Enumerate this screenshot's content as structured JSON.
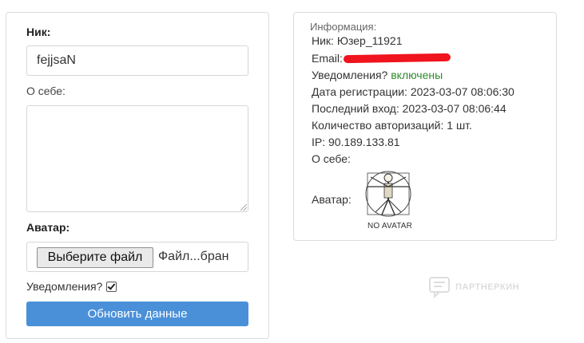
{
  "profile_form": {
    "nick_label": "Ник:",
    "nick_value": "fejjsaN",
    "about_label": "О себе:",
    "about_value": "",
    "avatar_label": "Аватар:",
    "file_button_label": "Выберите файл",
    "file_status": "Файл...бран",
    "notifications_label": "Уведомления?",
    "notifications_checked": true,
    "update_button_label": "Обновить данные"
  },
  "info": {
    "title": "Информация:",
    "nick": "Ник: Юзер_11921",
    "email_label": "Email:",
    "notifications_label": "Уведомления?",
    "notifications_value": "включены",
    "registered": "Дата регистрации: 2023-03-07 08:06:30",
    "last_login": "Последний вход: 2023-03-07 08:06:44",
    "auth_count": "Количество авторизаций: 1 шт.",
    "ip": "IP: 90.189.133.81",
    "about": "О себе:",
    "avatar_label": "Аватар:",
    "avatar_caption": "NO AVATAR",
    "redaction_color": "#f0141e"
  },
  "watermark": {
    "text": "ПАРТНЕРКИН"
  },
  "colors": {
    "primary_button": "#4a90d9",
    "enabled_text": "#2e8b2e"
  }
}
